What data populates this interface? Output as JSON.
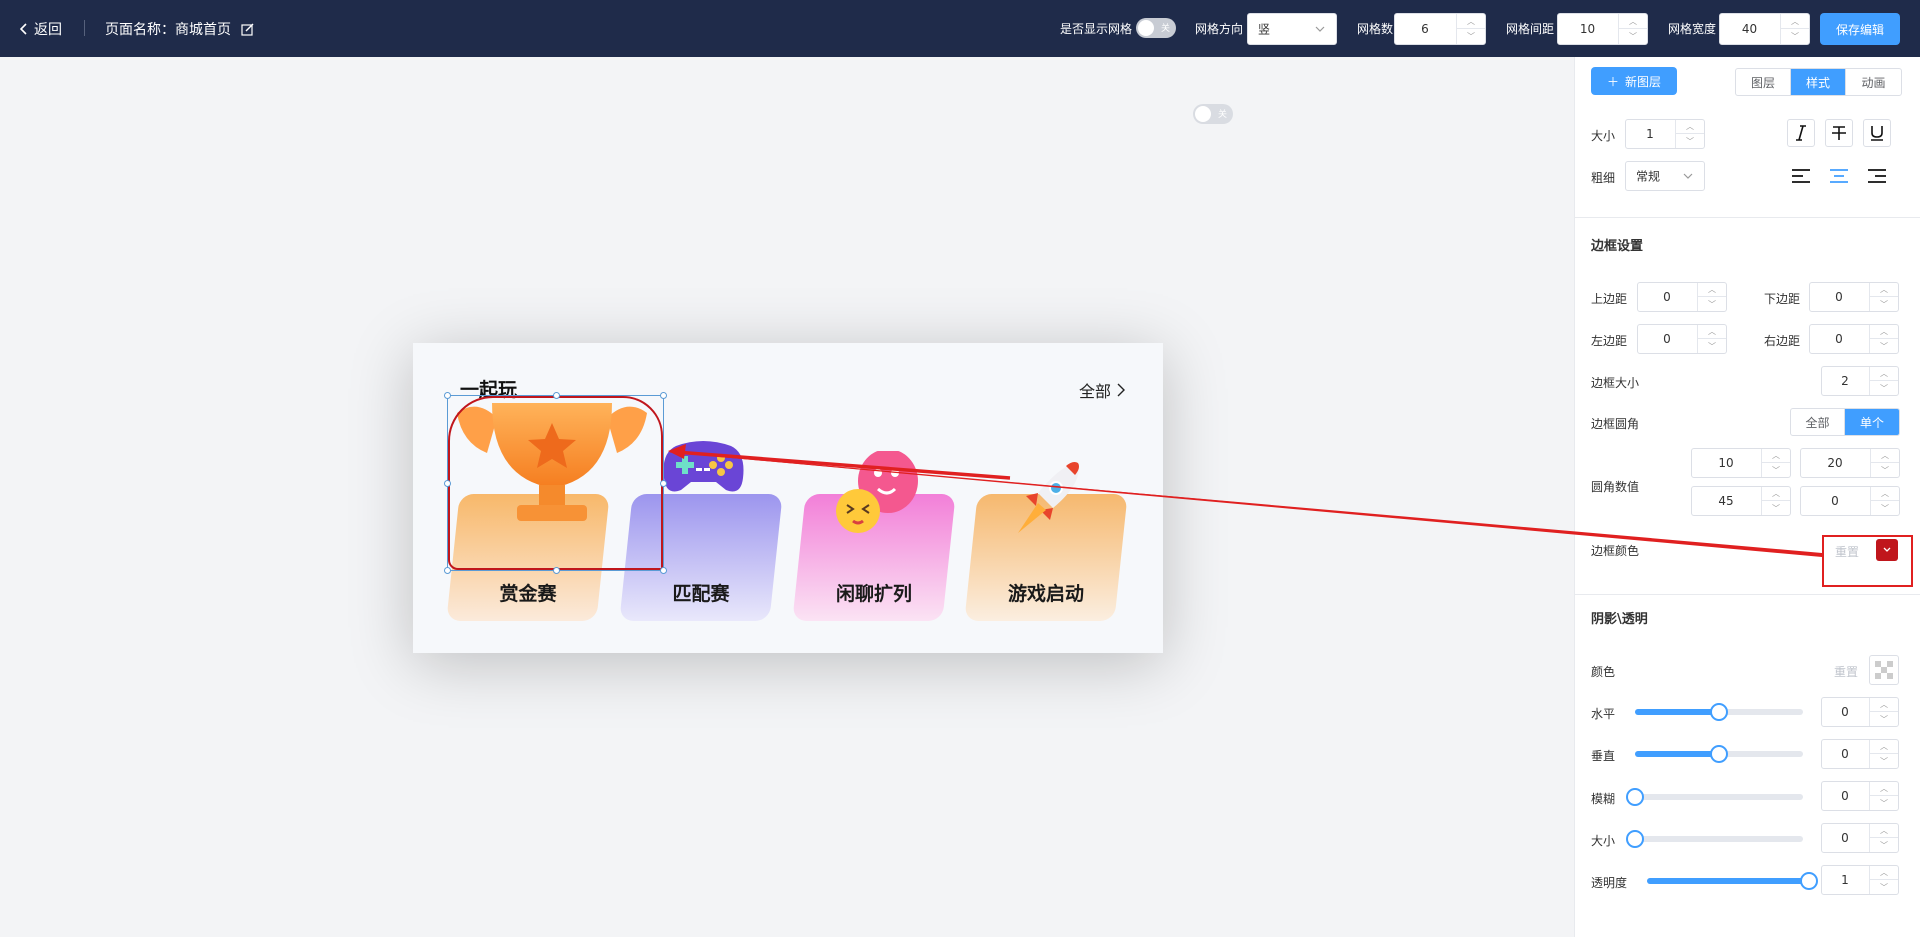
{
  "topbar": {
    "back_label": "返回",
    "page_name": "页面名称：商城首页",
    "show_grid_label": "是否显示网格",
    "grid_direction_label": "网格方向",
    "grid_direction_value": "竖",
    "grid_count_label": "网格数",
    "grid_count_value": "6",
    "grid_gap_label": "网格间距",
    "grid_gap_value": "10",
    "grid_width_label": "网格宽度",
    "grid_width_value": "40",
    "save_label": "保存编辑"
  },
  "canvas": {
    "card_title": "一起玩",
    "all_label": "全部",
    "tiles": [
      {
        "label": "赏金赛",
        "color_top": "#f8b86a",
        "color_bottom": "#fbeadb"
      },
      {
        "label": "匹配赛",
        "color_top": "#9c95ee",
        "color_bottom": "#e9e8fb"
      },
      {
        "label": "闲聊扩列",
        "color_top": "#f27fd8",
        "color_bottom": "#fbe3f4"
      },
      {
        "label": "游戏启动",
        "color_top": "#f6b86e",
        "color_bottom": "#fbeee0"
      }
    ]
  },
  "panel": {
    "new_layer": "新图层",
    "tabs": [
      "图层",
      "样式",
      "动画"
    ],
    "active_tab": "样式",
    "size_label": "大小",
    "size_value": "1",
    "weight_label": "粗细",
    "weight_value": "常规",
    "border_section": "边框设置",
    "margin_top_label": "上边距",
    "margin_top_value": "0",
    "margin_bottom_label": "下边距",
    "margin_bottom_value": "0",
    "margin_left_label": "左边距",
    "margin_left_value": "0",
    "margin_right_label": "右边距",
    "margin_right_value": "0",
    "border_size_label": "边框大小",
    "border_size_value": "2",
    "border_radius_label": "边框圆角",
    "radius_modes": [
      "全部",
      "单个"
    ],
    "radius_active": "单个",
    "radius_values_label": "圆角数值",
    "radius_tl": "10",
    "radius_tr": "20",
    "radius_bl": "45",
    "radius_br": "0",
    "border_color_label": "边框颜色",
    "border_color_reset": "重置",
    "border_color": "#c0161c",
    "shadow_section": "阴影\\透明",
    "shadow_color_label": "颜色",
    "shadow_color_reset": "重置",
    "h_label": "水平",
    "h_value": "0",
    "v_label": "垂直",
    "v_value": "0",
    "blur_label": "模糊",
    "blur_value": "0",
    "spread_label": "大小",
    "spread_value": "0",
    "opacity_label": "透明度",
    "opacity_value": "1",
    "sliders": {
      "h": 0.5,
      "v": 0.5,
      "blur": 0,
      "spread": 0,
      "opacity": 1
    }
  },
  "colors": {
    "accent": "#409eff",
    "topbar": "#1f2b4a",
    "annotation": "#e02020"
  }
}
